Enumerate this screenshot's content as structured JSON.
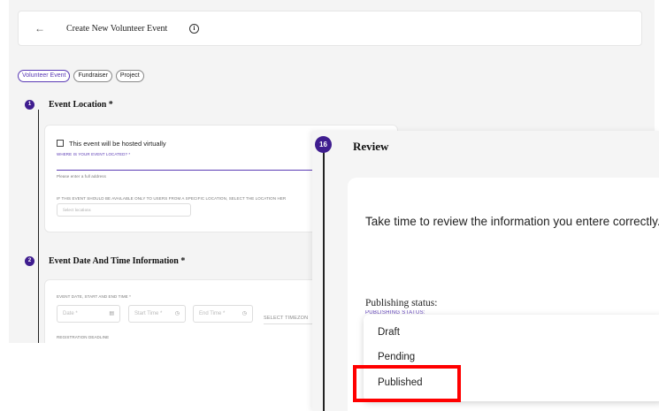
{
  "header": {
    "back_icon": "arrow-left-icon",
    "title": "Create New Volunteer Event",
    "info_icon": "i"
  },
  "tabs": [
    {
      "label": "Volunteer Event",
      "active": true
    },
    {
      "label": "Fundraiser",
      "active": false
    },
    {
      "label": "Project",
      "active": false
    }
  ],
  "section1": {
    "step": "1",
    "title": "Event Location *",
    "virtual_checkbox_label": "This event will be hosted virtually",
    "location_label": "WHERE IS YOUR EVENT LOCATED? *",
    "address_hint": "Please enter a full address",
    "restrict_label": "IF THIS EVENT SHOULD BE AVAILABLE ONLY TO USERS FROM A SPECIFIC LOCATION, SELECT THE LOCATION HER",
    "locations_placeholder": "Select locations"
  },
  "section2": {
    "step": "2",
    "title": "Event Date And Time Information *",
    "datetime_label": "EVENT DATE, START AND END TIME *",
    "date_placeholder": "Date *",
    "start_placeholder": "Start Time *",
    "end_placeholder": "End Time *",
    "timezone_label": "SELECT TIMEZON",
    "registration_label": "REGISTRATION DEADLINE"
  },
  "review": {
    "step": "16",
    "title": "Review",
    "body_text": "Take time to review the information you entere correctly.",
    "publishing_label": "Publishing status:",
    "publishing_sublabel": "PUBLISHING STATUS:",
    "options": [
      "Draft",
      "Pending",
      "Published"
    ],
    "highlighted_option": "Published"
  },
  "colors": {
    "accent": "#5b3bb5",
    "step_dot": "#3f1d8f",
    "highlight": "#ff0000"
  }
}
